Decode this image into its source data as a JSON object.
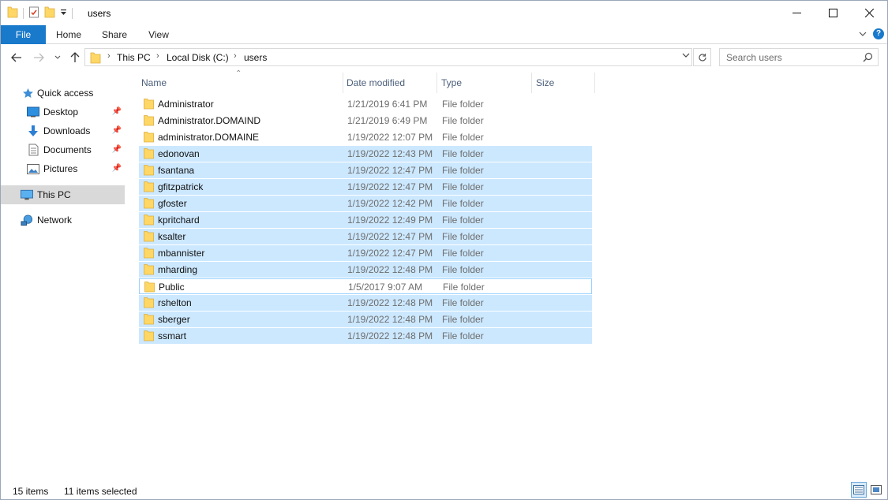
{
  "window": {
    "title": "users"
  },
  "ribbon": {
    "tabs": [
      "File",
      "Home",
      "Share",
      "View"
    ]
  },
  "address": {
    "crumbs": [
      "This PC",
      "Local Disk (C:)",
      "users"
    ]
  },
  "search": {
    "placeholder": "Search users"
  },
  "sidebar": {
    "quick_access": "Quick access",
    "items": [
      {
        "label": "Desktop",
        "icon": "desktop-icon",
        "pinned": true
      },
      {
        "label": "Downloads",
        "icon": "downloads-icon",
        "pinned": true
      },
      {
        "label": "Documents",
        "icon": "documents-icon",
        "pinned": true
      },
      {
        "label": "Pictures",
        "icon": "pictures-icon",
        "pinned": true
      }
    ],
    "this_pc": "This PC",
    "network": "Network"
  },
  "columns": {
    "name": "Name",
    "date": "Date modified",
    "type": "Type",
    "size": "Size"
  },
  "files": [
    {
      "name": "Administrator",
      "date": "1/21/2019 6:41 PM",
      "type": "File folder",
      "state": "normal"
    },
    {
      "name": "Administrator.DOMAIND",
      "date": "1/21/2019 6:49 PM",
      "type": "File folder",
      "state": "normal"
    },
    {
      "name": "administrator.DOMAINE",
      "date": "1/19/2022 12:07 PM",
      "type": "File folder",
      "state": "normal"
    },
    {
      "name": "edonovan",
      "date": "1/19/2022 12:43 PM",
      "type": "File folder",
      "state": "selected"
    },
    {
      "name": "fsantana",
      "date": "1/19/2022 12:47 PM",
      "type": "File folder",
      "state": "selected"
    },
    {
      "name": "gfitzpatrick",
      "date": "1/19/2022 12:47 PM",
      "type": "File folder",
      "state": "selected"
    },
    {
      "name": "gfoster",
      "date": "1/19/2022 12:42 PM",
      "type": "File folder",
      "state": "selected"
    },
    {
      "name": "kpritchard",
      "date": "1/19/2022 12:49 PM",
      "type": "File folder",
      "state": "selected"
    },
    {
      "name": "ksalter",
      "date": "1/19/2022 12:47 PM",
      "type": "File folder",
      "state": "selected"
    },
    {
      "name": "mbannister",
      "date": "1/19/2022 12:47 PM",
      "type": "File folder",
      "state": "selected"
    },
    {
      "name": "mharding",
      "date": "1/19/2022 12:48 PM",
      "type": "File folder",
      "state": "selected"
    },
    {
      "name": "Public",
      "date": "1/5/2017 9:07 AM",
      "type": "File folder",
      "state": "focused"
    },
    {
      "name": "rshelton",
      "date": "1/19/2022 12:48 PM",
      "type": "File folder",
      "state": "selected"
    },
    {
      "name": "sberger",
      "date": "1/19/2022 12:48 PM",
      "type": "File folder",
      "state": "selected"
    },
    {
      "name": "ssmart",
      "date": "1/19/2022 12:48 PM",
      "type": "File folder",
      "state": "selected"
    }
  ],
  "status": {
    "count": "15 items",
    "selected": "11 items selected"
  },
  "colors": {
    "accent": "#1979ca",
    "selection": "#cce8ff",
    "focus_border": "#99d1ff",
    "folder": "#ffd766"
  }
}
